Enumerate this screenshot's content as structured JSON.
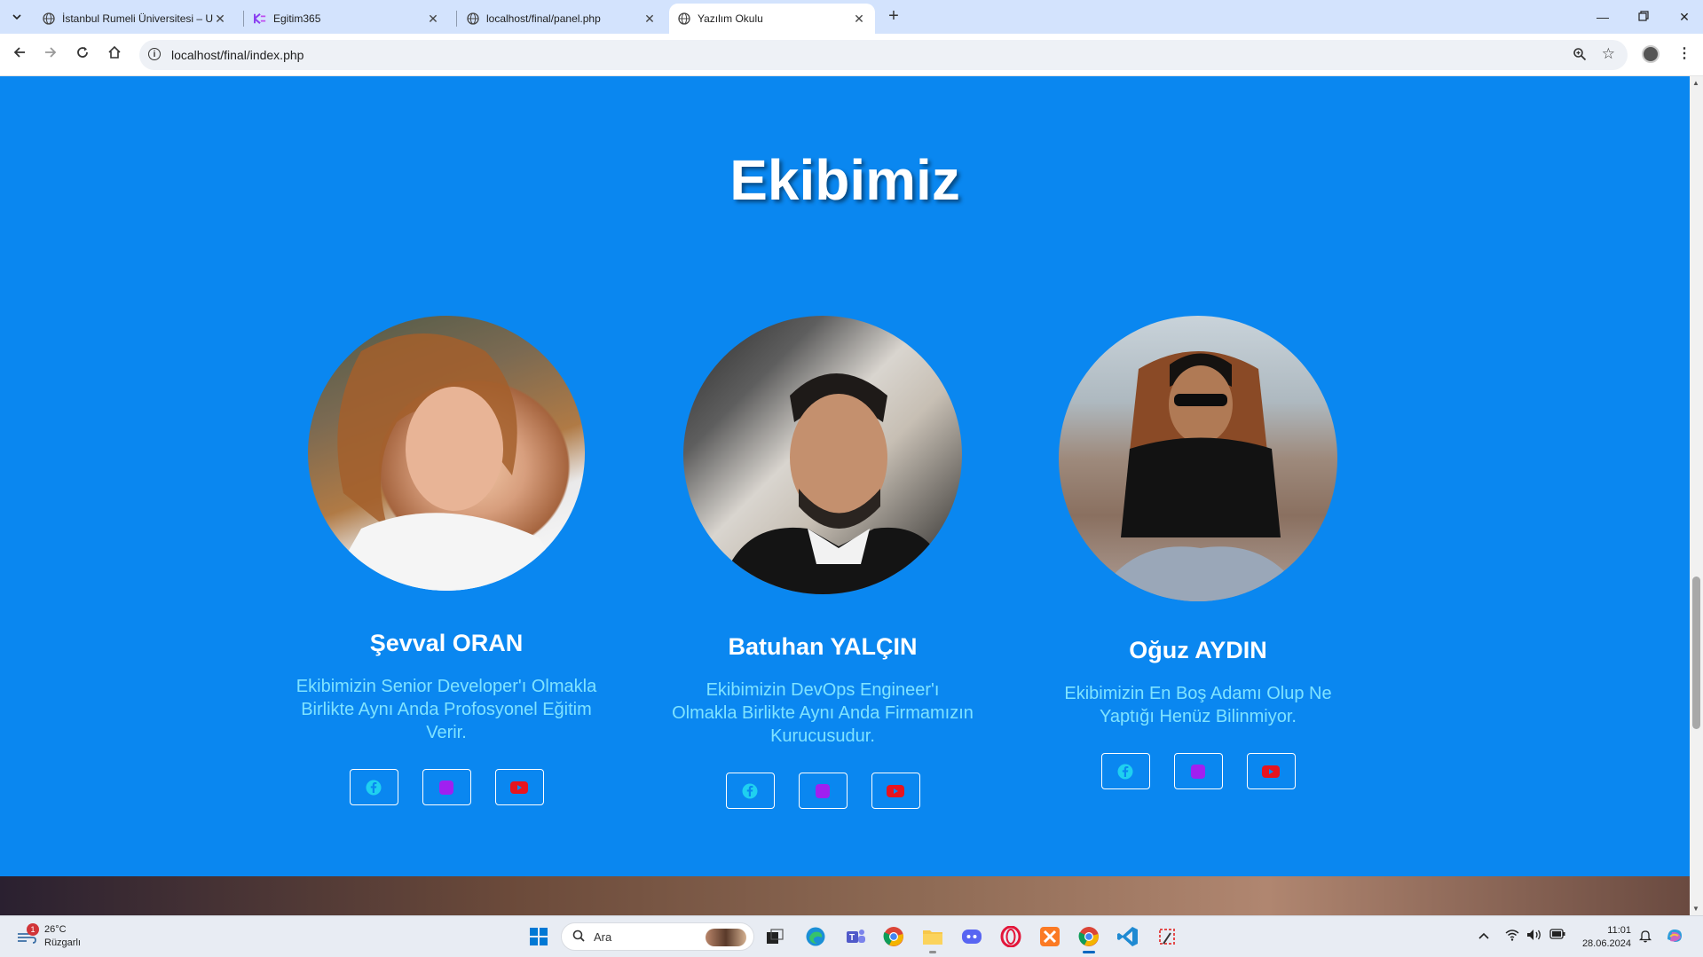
{
  "browser": {
    "tabs": [
      {
        "title": "İstanbul Rumeli Üniversitesi – U",
        "active": false
      },
      {
        "title": "Egitim365",
        "active": false
      },
      {
        "title": "localhost/final/panel.php",
        "active": false
      },
      {
        "title": "Yazılım Okulu",
        "active": true
      }
    ],
    "url": "localhost/final/index.php"
  },
  "page": {
    "section_title": "Ekibimiz",
    "members": [
      {
        "name": "Şevval ORAN",
        "description": "Ekibimizin Senior Developer'ı Olmakla Birlikte Aynı Anda Profosyonel Eğitim Verir.",
        "photo_alt": "portrait-photo"
      },
      {
        "name": "Batuhan YALÇIN",
        "description": "Ekibimizin DevOps Engineer'ı Olmakla Birlikte Aynı Anda Firmamızın Kurucusudur.",
        "photo_alt": "portrait-photo"
      },
      {
        "name": "Oğuz AYDIN",
        "description": "Ekibimizin En Boş Adamı Olup Ne Yaptığı Henüz Bilinmiyor.",
        "photo_alt": "portrait-photo"
      }
    ],
    "social_icons": [
      "facebook-icon",
      "instagram-icon",
      "youtube-icon"
    ],
    "colors": {
      "background": "#0a87f0",
      "description_text": "#7fe3ff",
      "facebook": "#1fd0f0",
      "instagram": "#a020f0",
      "youtube": "#e8141e"
    }
  },
  "taskbar": {
    "weather_temp": "26°C",
    "weather_desc": "Rüzgarlı",
    "weather_badge": "1",
    "search_placeholder": "Ara",
    "time": "11:01",
    "date": "28.06.2024"
  }
}
